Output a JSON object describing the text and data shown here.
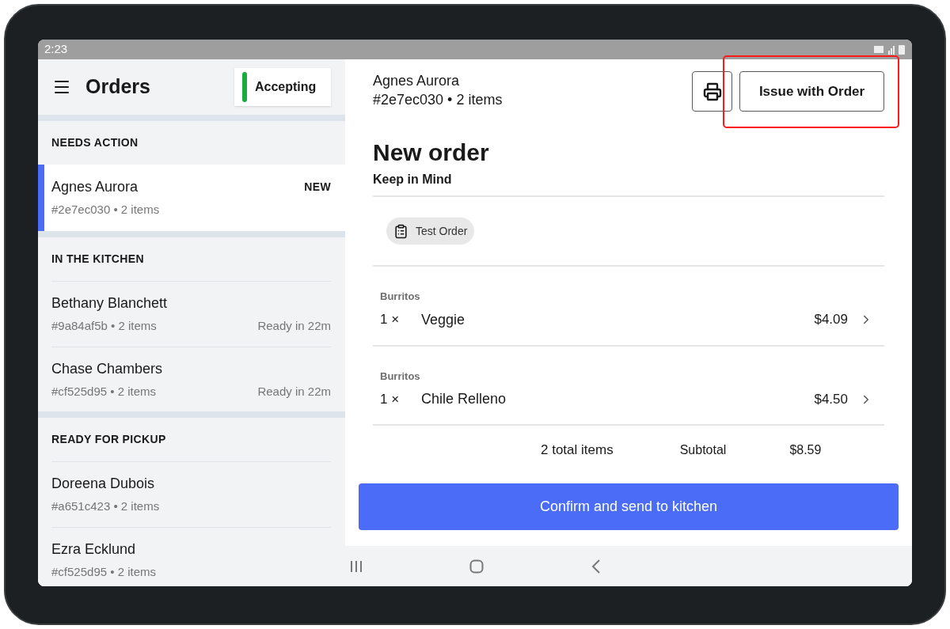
{
  "status_bar": {
    "time": "2:23"
  },
  "sidebar": {
    "title": "Orders",
    "store_status": {
      "label": "Accepting",
      "on": true
    },
    "sections": [
      {
        "heading": "NEEDS ACTION",
        "orders": [
          {
            "name": "Agnes Aurora",
            "summary": "#2e7ec030 • 2 items",
            "badge": "NEW",
            "selected": true
          }
        ]
      },
      {
        "heading": "IN THE KITCHEN",
        "orders": [
          {
            "name": "Bethany Blanchett",
            "summary": "#9a84af5b • 2 items",
            "eta": "Ready in 22m",
            "selected": false
          },
          {
            "name": "Chase Chambers",
            "summary": "#cf525d95 • 2 items",
            "eta": "Ready in 22m",
            "selected": false
          }
        ]
      },
      {
        "heading": "READY FOR PICKUP",
        "orders": [
          {
            "name": "Doreena Dubois",
            "summary": "#a651c423 • 2 items",
            "selected": false
          },
          {
            "name": "Ezra Ecklund",
            "summary": "#cf525d95 • 2 items",
            "selected": false
          }
        ]
      }
    ]
  },
  "order": {
    "customer": "Agnes Aurora",
    "summary": "#2e7ec030 • 2 items",
    "issue_button": {
      "label": "Issue with Order",
      "highlighted": true
    },
    "title": "New order",
    "notes_heading": "Keep in Mind",
    "tags": [
      "Test Order"
    ],
    "items": [
      {
        "category": "Burritos",
        "quantity": "1 ×",
        "name": "Veggie",
        "price": "$4.09"
      },
      {
        "category": "Burritos",
        "quantity": "1 ×",
        "name": "Chile Relleno",
        "price": "$4.50"
      }
    ],
    "totals": {
      "count": "2 total items",
      "label": "Subtotal",
      "amount": "$8.59"
    },
    "confirm_button": "Confirm and send to kitchen"
  }
}
